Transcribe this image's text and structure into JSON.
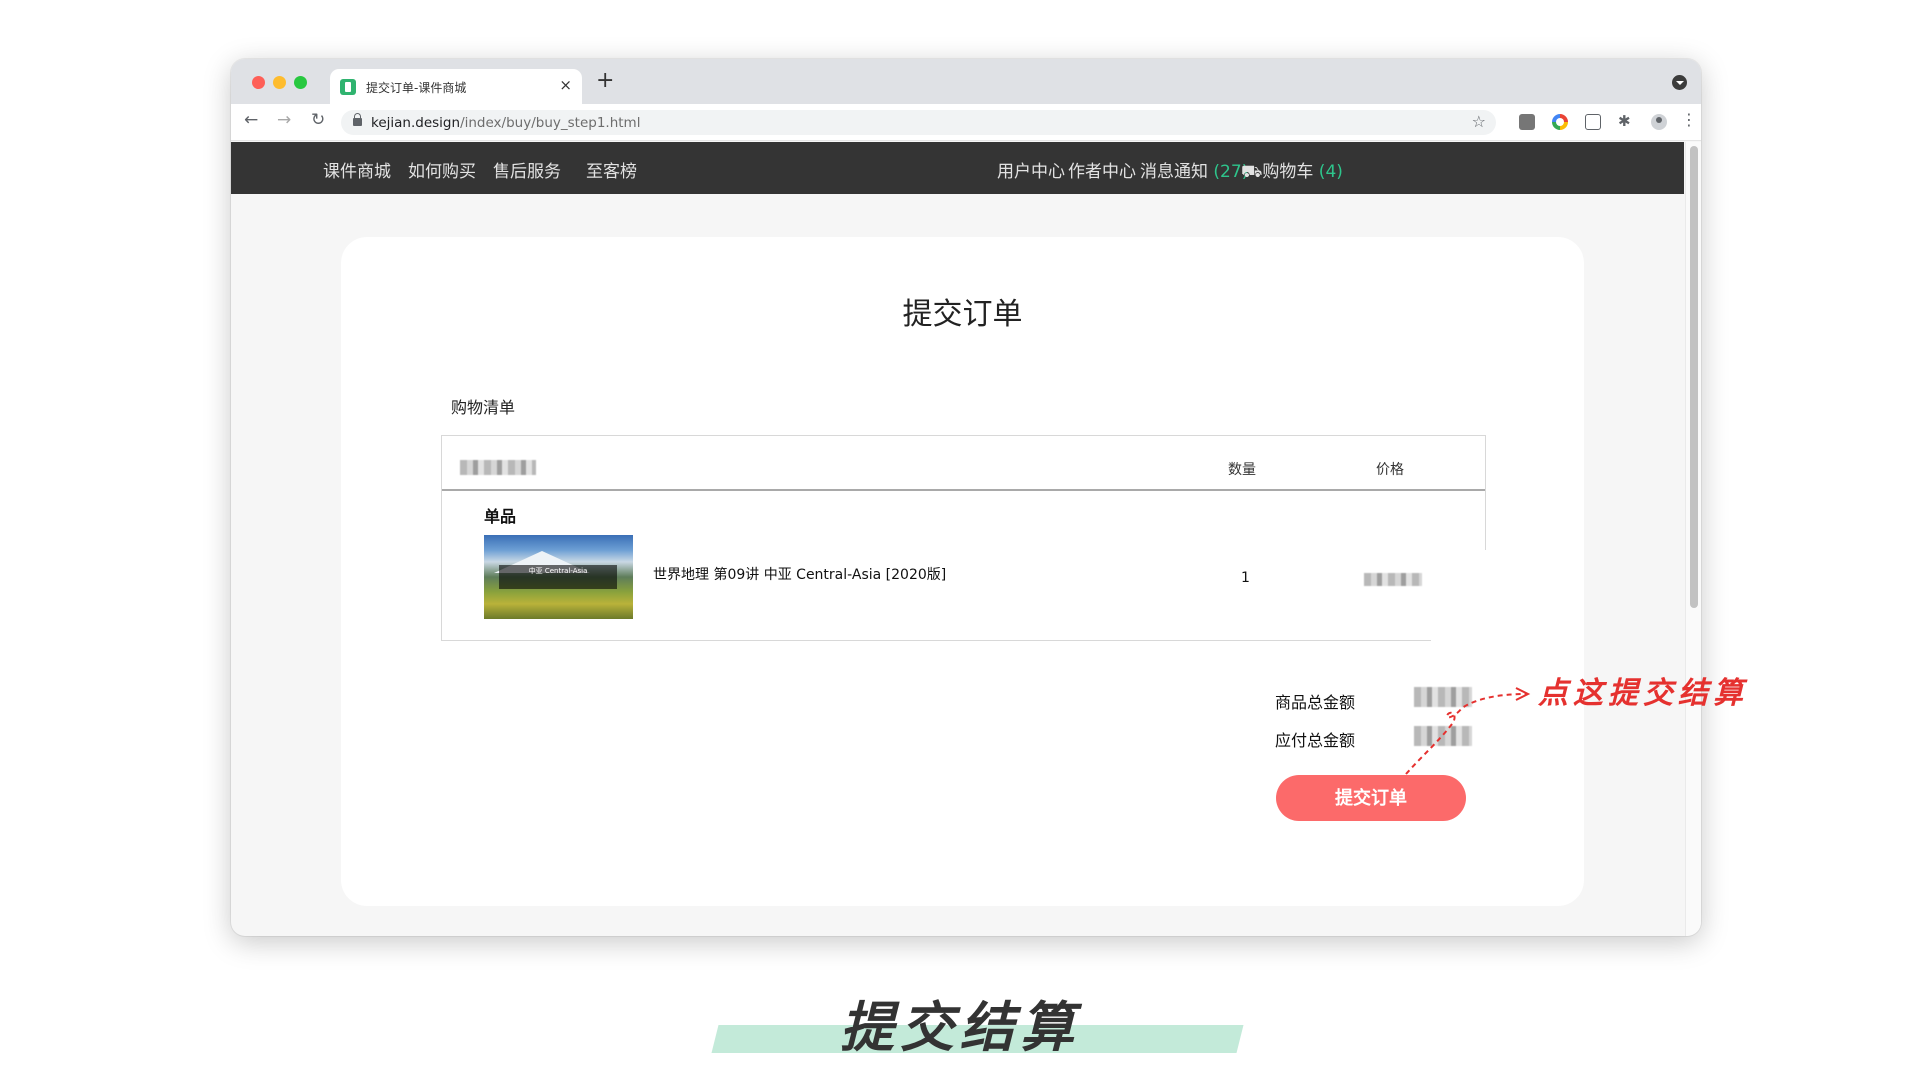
{
  "browser": {
    "tab_title": "提交订单-课件商城",
    "tab_close": "×",
    "new_tab": "+",
    "url_host": "kejian.design",
    "url_path": "/index/buy/buy_step1.html",
    "icons": [
      "back-arrow-icon",
      "forward-arrow-icon",
      "reload-icon",
      "lock-icon",
      "star-icon",
      "extension-icon",
      "profile-icon",
      "menu-icon"
    ]
  },
  "site_nav": {
    "left": [
      "课件商城",
      "如何购买",
      "售后服务",
      "至客榜"
    ],
    "user_center": "用户中心",
    "author_center": "作者中心",
    "messages_label": "消息通知",
    "messages_count": "27",
    "cart_label": "购物车",
    "cart_count": "4"
  },
  "page": {
    "title": "提交订单",
    "list_title": "购物清单"
  },
  "table": {
    "col_qty": "数量",
    "col_price": "价格",
    "group_label": "单品",
    "item": {
      "name": "世界地理 第09讲 中亚 Central-Asia [2020版]",
      "qty": "1",
      "thumbnail_title": "中亚 Central-Asia"
    }
  },
  "summary": {
    "goods_total_label": "商品总金额",
    "payable_total_label": "应付总金额",
    "submit_label": "提交订单"
  },
  "annotation": {
    "text": "点这提交结算"
  },
  "caption": "提交结算",
  "colors": {
    "nav_bg": "#343434",
    "count_accent": "#2ec58c",
    "submit_button": "#fc6a6a",
    "annotation": "#e5312f",
    "caption_band": "#c3ead9"
  }
}
